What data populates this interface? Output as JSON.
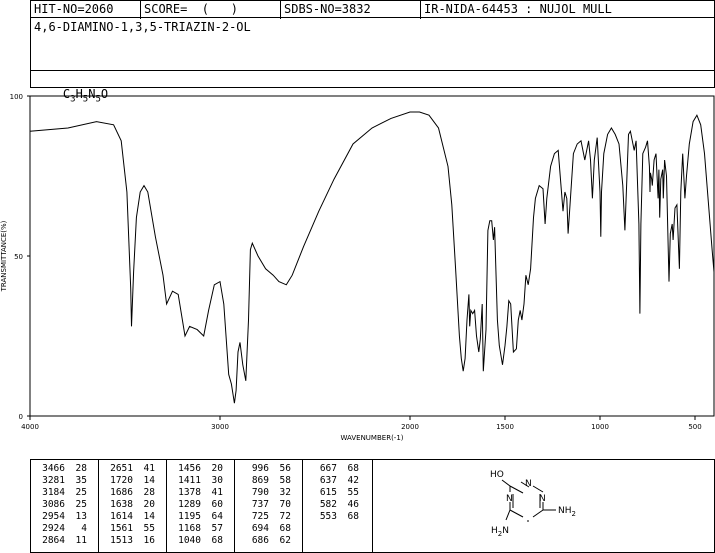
{
  "header": {
    "hit_no": "HIT-NO=2060",
    "score": "SCORE=  (   )",
    "sdbs_no": "SDBS-NO=3832",
    "ir_id": "IR-NIDA-64453 : NUJOL MULL",
    "compound_name": "4,6-DIAMINO-1,3,5-TRIAZIN-2-OL",
    "formula_parts": [
      "C",
      "3",
      "H",
      "5",
      "N",
      "5",
      "O"
    ]
  },
  "chart_data": {
    "type": "line",
    "xlabel": "WAVENUMBER(-1)",
    "ylabel": "TRANSMITTANCE(%)",
    "xlim": [
      4000,
      400
    ],
    "ylim": [
      0,
      100
    ],
    "xticks": [
      "4000",
      "3000",
      "2000",
      "1500",
      "1000",
      "500"
    ],
    "xtick_values": [
      4000,
      3000,
      2000,
      1500,
      1000,
      500
    ],
    "yticks": [
      "0",
      "50",
      "100"
    ],
    "ytick_values": [
      0,
      50,
      100
    ],
    "line_color": "#000000",
    "points": [
      [
        4000,
        89
      ],
      [
        3800,
        90
      ],
      [
        3650,
        92
      ],
      [
        3560,
        91
      ],
      [
        3520,
        86
      ],
      [
        3490,
        70
      ],
      [
        3470,
        40
      ],
      [
        3466,
        28
      ],
      [
        3455,
        45
      ],
      [
        3440,
        62
      ],
      [
        3420,
        70
      ],
      [
        3400,
        72
      ],
      [
        3380,
        70
      ],
      [
        3340,
        56
      ],
      [
        3300,
        44
      ],
      [
        3281,
        35
      ],
      [
        3250,
        39
      ],
      [
        3220,
        38
      ],
      [
        3184,
        25
      ],
      [
        3160,
        28
      ],
      [
        3120,
        27
      ],
      [
        3086,
        25
      ],
      [
        3060,
        33
      ],
      [
        3030,
        41
      ],
      [
        3000,
        42
      ],
      [
        2980,
        35
      ],
      [
        2954,
        13
      ],
      [
        2940,
        10
      ],
      [
        2924,
        4
      ],
      [
        2915,
        8
      ],
      [
        2905,
        20
      ],
      [
        2895,
        23
      ],
      [
        2880,
        16
      ],
      [
        2864,
        11
      ],
      [
        2850,
        30
      ],
      [
        2840,
        52
      ],
      [
        2830,
        54
      ],
      [
        2800,
        50
      ],
      [
        2760,
        46
      ],
      [
        2720,
        44
      ],
      [
        2690,
        42
      ],
      [
        2651,
        41
      ],
      [
        2620,
        44
      ],
      [
        2560,
        53
      ],
      [
        2480,
        64
      ],
      [
        2400,
        74
      ],
      [
        2300,
        85
      ],
      [
        2200,
        90
      ],
      [
        2100,
        93
      ],
      [
        2000,
        95
      ],
      [
        1950,
        95
      ],
      [
        1900,
        94
      ],
      [
        1850,
        90
      ],
      [
        1800,
        78
      ],
      [
        1780,
        66
      ],
      [
        1760,
        46
      ],
      [
        1740,
        25
      ],
      [
        1730,
        18
      ],
      [
        1720,
        14
      ],
      [
        1710,
        18
      ],
      [
        1700,
        30
      ],
      [
        1690,
        38
      ],
      [
        1686,
        28
      ],
      [
        1680,
        33
      ],
      [
        1670,
        32
      ],
      [
        1660,
        33
      ],
      [
        1650,
        25
      ],
      [
        1638,
        20
      ],
      [
        1630,
        24
      ],
      [
        1620,
        35
      ],
      [
        1614,
        14
      ],
      [
        1600,
        27
      ],
      [
        1590,
        58
      ],
      [
        1580,
        61
      ],
      [
        1570,
        61
      ],
      [
        1561,
        55
      ],
      [
        1555,
        59
      ],
      [
        1540,
        30
      ],
      [
        1530,
        22
      ],
      [
        1513,
        16
      ],
      [
        1500,
        22
      ],
      [
        1490,
        28
      ],
      [
        1480,
        36
      ],
      [
        1470,
        35
      ],
      [
        1456,
        20
      ],
      [
        1440,
        21
      ],
      [
        1430,
        30
      ],
      [
        1420,
        33
      ],
      [
        1411,
        30
      ],
      [
        1400,
        35
      ],
      [
        1390,
        44
      ],
      [
        1378,
        41
      ],
      [
        1365,
        46
      ],
      [
        1350,
        62
      ],
      [
        1340,
        68
      ],
      [
        1320,
        72
      ],
      [
        1300,
        71
      ],
      [
        1289,
        60
      ],
      [
        1280,
        68
      ],
      [
        1260,
        78
      ],
      [
        1240,
        82
      ],
      [
        1220,
        83
      ],
      [
        1195,
        64
      ],
      [
        1185,
        70
      ],
      [
        1175,
        68
      ],
      [
        1168,
        57
      ],
      [
        1160,
        64
      ],
      [
        1140,
        82
      ],
      [
        1120,
        85
      ],
      [
        1100,
        86
      ],
      [
        1080,
        80
      ],
      [
        1060,
        86
      ],
      [
        1050,
        80
      ],
      [
        1040,
        68
      ],
      [
        1030,
        80
      ],
      [
        1015,
        87
      ],
      [
        1000,
        70
      ],
      [
        996,
        56
      ],
      [
        992,
        70
      ],
      [
        980,
        82
      ],
      [
        960,
        88
      ],
      [
        940,
        90
      ],
      [
        920,
        88
      ],
      [
        900,
        85
      ],
      [
        880,
        72
      ],
      [
        869,
        58
      ],
      [
        860,
        72
      ],
      [
        850,
        88
      ],
      [
        840,
        89
      ],
      [
        830,
        86
      ],
      [
        820,
        83
      ],
      [
        810,
        86
      ],
      [
        795,
        60
      ],
      [
        790,
        32
      ],
      [
        785,
        60
      ],
      [
        775,
        82
      ],
      [
        760,
        84
      ],
      [
        750,
        86
      ],
      [
        740,
        78
      ],
      [
        737,
        70
      ],
      [
        735,
        76
      ],
      [
        728,
        74
      ],
      [
        725,
        72
      ],
      [
        715,
        80
      ],
      [
        705,
        82
      ],
      [
        694,
        68
      ],
      [
        690,
        77
      ],
      [
        686,
        62
      ],
      [
        680,
        74
      ],
      [
        670,
        77
      ],
      [
        667,
        68
      ],
      [
        660,
        80
      ],
      [
        650,
        75
      ],
      [
        637,
        42
      ],
      [
        630,
        57
      ],
      [
        620,
        60
      ],
      [
        615,
        55
      ],
      [
        605,
        65
      ],
      [
        595,
        66
      ],
      [
        582,
        46
      ],
      [
        575,
        70
      ],
      [
        565,
        82
      ],
      [
        553,
        68
      ],
      [
        545,
        75
      ],
      [
        530,
        85
      ],
      [
        510,
        92
      ],
      [
        490,
        94
      ],
      [
        470,
        91
      ],
      [
        450,
        82
      ],
      [
        430,
        67
      ],
      [
        410,
        52
      ],
      [
        400,
        45
      ]
    ]
  },
  "peak_table": [
    [
      [
        "3466",
        "28"
      ],
      [
        "3281",
        "35"
      ],
      [
        "3184",
        "25"
      ],
      [
        "3086",
        "25"
      ],
      [
        "2954",
        "13"
      ],
      [
        "2924",
        "4"
      ],
      [
        "2864",
        "11"
      ]
    ],
    [
      [
        "2651",
        "41"
      ],
      [
        "1720",
        "14"
      ],
      [
        "1686",
        "28"
      ],
      [
        "1638",
        "20"
      ],
      [
        "1614",
        "14"
      ],
      [
        "1561",
        "55"
      ],
      [
        "1513",
        "16"
      ]
    ],
    [
      [
        "1456",
        "20"
      ],
      [
        "1411",
        "30"
      ],
      [
        "1378",
        "41"
      ],
      [
        "1289",
        "60"
      ],
      [
        "1195",
        "64"
      ],
      [
        "1168",
        "57"
      ],
      [
        "1040",
        "68"
      ]
    ],
    [
      [
        "996",
        "56"
      ],
      [
        "869",
        "58"
      ],
      [
        "790",
        "32"
      ],
      [
        "737",
        "70"
      ],
      [
        "725",
        "72"
      ],
      [
        "694",
        "68"
      ],
      [
        "686",
        "62"
      ]
    ],
    [
      [
        "667",
        "68"
      ],
      [
        "637",
        "42"
      ],
      [
        "615",
        "55"
      ],
      [
        "582",
        "46"
      ],
      [
        "553",
        "68"
      ]
    ]
  ],
  "structure_labels": {
    "oh": "HO",
    "nh2_right": "NH",
    "nh2_right_sub": "2",
    "nh2_left": "H",
    "nh2_left_sub": "2",
    "nh2_left_tail": "N",
    "ring_n": "N"
  }
}
